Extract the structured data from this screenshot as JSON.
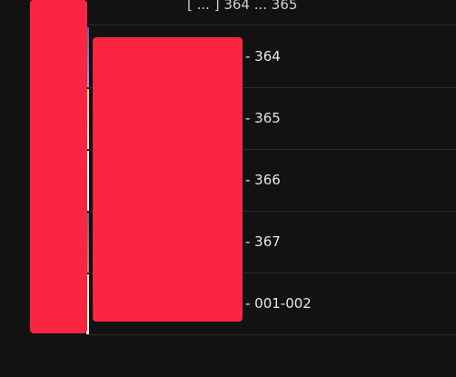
{
  "list": {
    "top_partial_title": "[ ... ] 364 ... 365",
    "items": [
      {
        "label": "- 364"
      },
      {
        "label": "- 365"
      },
      {
        "label": "- 366"
      },
      {
        "label": "- 367"
      },
      {
        "label": "- 001-002"
      }
    ]
  },
  "colors": {
    "background": "#121212",
    "redaction": "#fa2540",
    "text": "#e6e6e6",
    "divider": "#2a2a2a"
  }
}
